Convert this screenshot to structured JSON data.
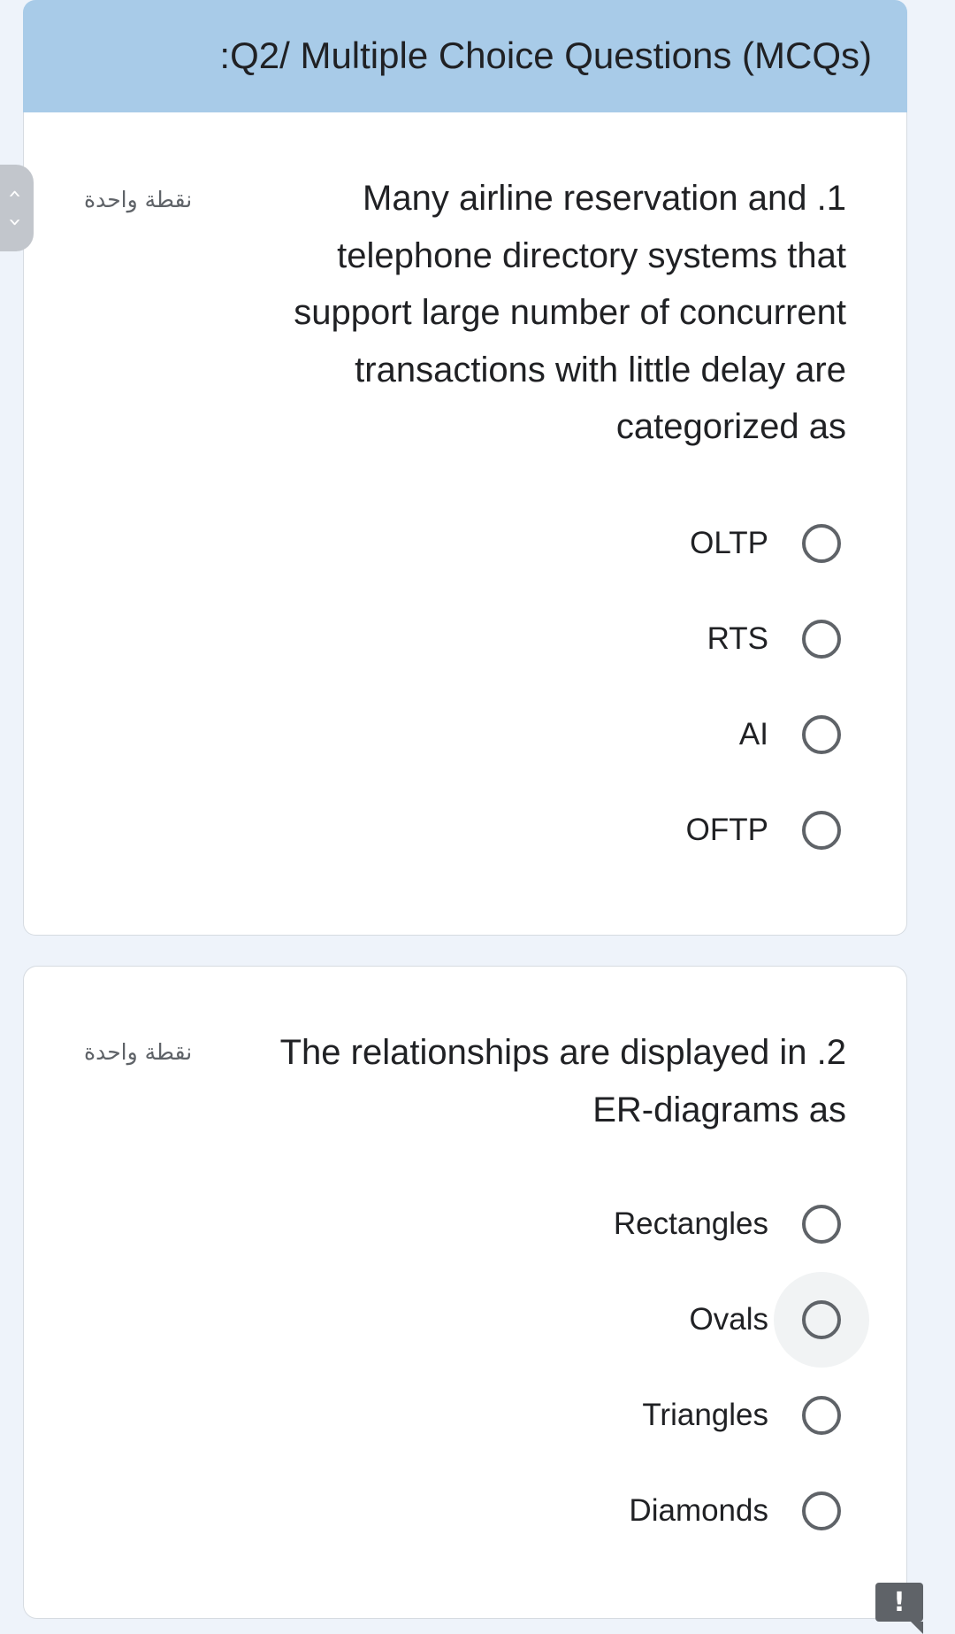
{
  "section": {
    "title": ":Q2/ Multiple Choice Questions (MCQs)"
  },
  "nav": {
    "up_icon": "chevron-up-icon",
    "down_icon": "chevron-down-icon",
    "up_glyph": "‹",
    "down_glyph": "›"
  },
  "questions": [
    {
      "lines": [
        "Many airline reservation and .1",
        "telephone directory systems that",
        "support large number of concurrent",
        "transactions with little delay are",
        "categorized as"
      ],
      "points": "نقطة واحدة",
      "options": [
        "OLTP",
        "RTS",
        "AI",
        "OFTP"
      ]
    },
    {
      "lines": [
        "The relationships are displayed in .2",
        "ER-diagrams as"
      ],
      "points": "نقطة واحدة",
      "options": [
        "Rectangles",
        "Ovals",
        "Triangles",
        "Diamonds"
      ]
    }
  ],
  "report": {
    "glyph": "!",
    "icon": "report-problem-icon"
  }
}
